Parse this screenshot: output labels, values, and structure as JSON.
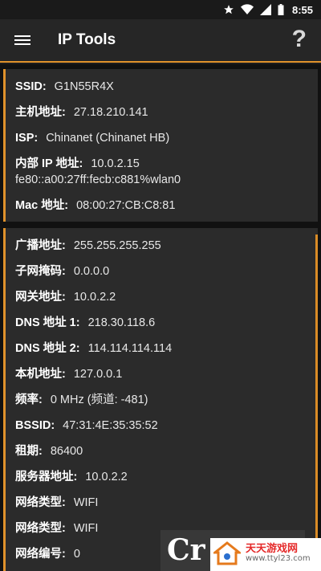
{
  "status_bar": {
    "time": "8:55",
    "icons": [
      "star-icon",
      "wifi-icon",
      "cell-signal-icon",
      "battery-icon"
    ]
  },
  "app_bar": {
    "title": "IP Tools",
    "menu_icon": "hamburger-menu-icon",
    "help_glyph": "?"
  },
  "card1": {
    "ssid_label": "SSID:",
    "ssid_value": "G1N55R4X",
    "host_label": "主机地址:",
    "host_value": "27.18.210.141",
    "isp_label": "ISP:",
    "isp_value": "Chinanet (Chinanet HB)",
    "internal_ip_label": "内部 IP 地址:",
    "internal_ip_value": "10.0.2.15",
    "internal_ipv6": "fe80::a00:27ff:fecb:c881%wlan0",
    "mac_label": "Mac 地址:",
    "mac_value": "08:00:27:CB:C8:81"
  },
  "card2": {
    "rows": [
      {
        "label": "广播地址:",
        "value": "255.255.255.255"
      },
      {
        "label": "子网掩码:",
        "value": "0.0.0.0"
      },
      {
        "label": "网关地址:",
        "value": "10.0.2.2"
      },
      {
        "label": "DNS 地址 1:",
        "value": "218.30.118.6"
      },
      {
        "label": "DNS 地址 2:",
        "value": "114.114.114.114"
      },
      {
        "label": "本机地址:",
        "value": "127.0.0.1"
      },
      {
        "label": "频率:",
        "value": "0 MHz (频道: -481)"
      },
      {
        "label": "BSSID:",
        "value": "47:31:4E:35:35:52"
      },
      {
        "label": "租期:",
        "value": "86400"
      },
      {
        "label": "服务器地址:",
        "value": "10.0.2.2"
      },
      {
        "label": "网络类型:",
        "value": "WIFI"
      },
      {
        "label": "网络类型:",
        "value": "WIFI"
      },
      {
        "label": "网络编号:",
        "value": "0"
      }
    ]
  },
  "watermark": {
    "cr_text": "Cr",
    "site_name": "天天游戏网",
    "site_url": "www.ttyl23.com"
  },
  "colors": {
    "accent": "#e0922b",
    "card_bg": "#2b2b2b",
    "app_bar_bg": "#262626"
  }
}
